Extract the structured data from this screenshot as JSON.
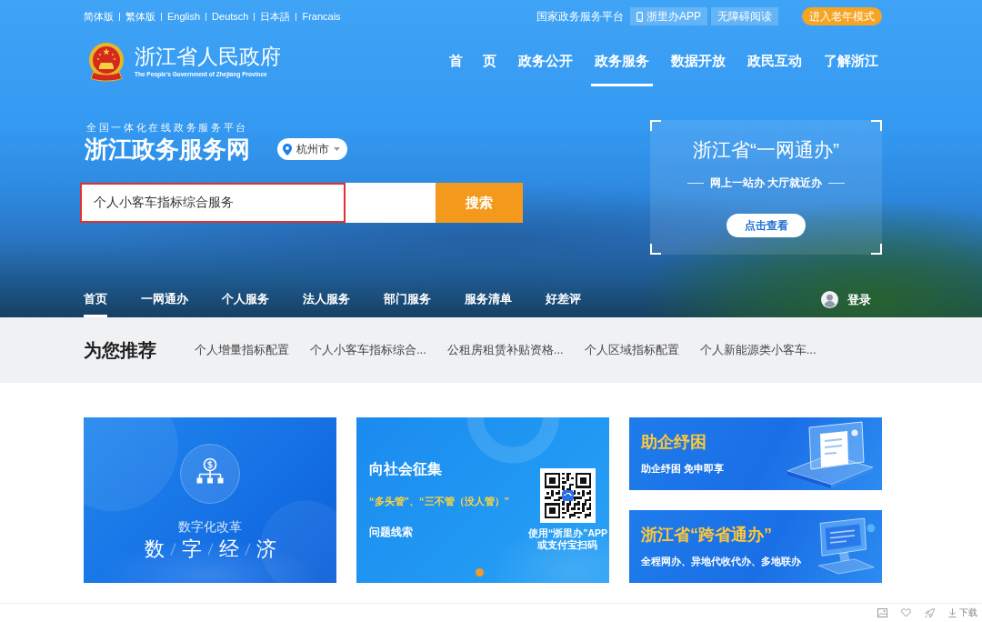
{
  "top_bar": {
    "languages": [
      "简体版",
      "繁体版",
      "English",
      "Deutsch",
      "日本語",
      "Francais"
    ],
    "platform_link": "国家政务服务平台",
    "app_button": "浙里办APP",
    "accessibility_button": "无障碍阅读",
    "elder_mode_button": "进入老年模式"
  },
  "header": {
    "title": "浙江省人民政府",
    "subtitle": "The People's Government of Zhejiang Province",
    "nav": [
      {
        "label": "首 页",
        "selected": false
      },
      {
        "label": "政务公开",
        "selected": false
      },
      {
        "label": "政务服务",
        "selected": true
      },
      {
        "label": "数据开放",
        "selected": false
      },
      {
        "label": "政民互动",
        "selected": false
      },
      {
        "label": "了解浙江",
        "selected": false
      }
    ]
  },
  "hero": {
    "tagline": "全国一体化在线政务服务平台",
    "title": "浙江政务服务网",
    "location": "杭州市",
    "search": {
      "value": "个人小客车指标综合服务",
      "highlighted": true,
      "button": "搜索"
    },
    "promo": {
      "title": "浙江省“一网通办”",
      "subtitle": "网上一站办 大厅就近办",
      "button": "点击查看"
    }
  },
  "sub_nav": {
    "items": [
      {
        "label": "首页",
        "selected": true
      },
      {
        "label": "一网通办",
        "selected": false
      },
      {
        "label": "个人服务",
        "selected": false
      },
      {
        "label": "法人服务",
        "selected": false
      },
      {
        "label": "部门服务",
        "selected": false
      },
      {
        "label": "服务清单",
        "selected": false
      },
      {
        "label": "好差评",
        "selected": false
      }
    ],
    "login": "登录"
  },
  "recommend": {
    "title": "为您推荐",
    "items": [
      "个人增量指标配置",
      "个人小客车指标综合...",
      "公租房租赁补贴资格...",
      "个人区域指标配置",
      "个人新能源类小客车..."
    ]
  },
  "cards": [
    {
      "kind": "feature",
      "caption": "数字化改革",
      "title": "数字经济"
    },
    {
      "kind": "qr",
      "title": "向社会征集",
      "highlight": "“多头管”、“三不管（没人管）”",
      "text": "问题线索",
      "qr_caption": [
        "使用“浙里办”APP",
        "或支付宝扫码"
      ]
    },
    {
      "kind": "tray",
      "title": "助企纾困",
      "text": "助企纾困 免申即享"
    },
    {
      "kind": "monitor",
      "title": "浙江省“跨省通办”",
      "text": "全程网办、异地代收代办、多地联办"
    }
  ],
  "toolbar": {
    "download": "下载"
  }
}
